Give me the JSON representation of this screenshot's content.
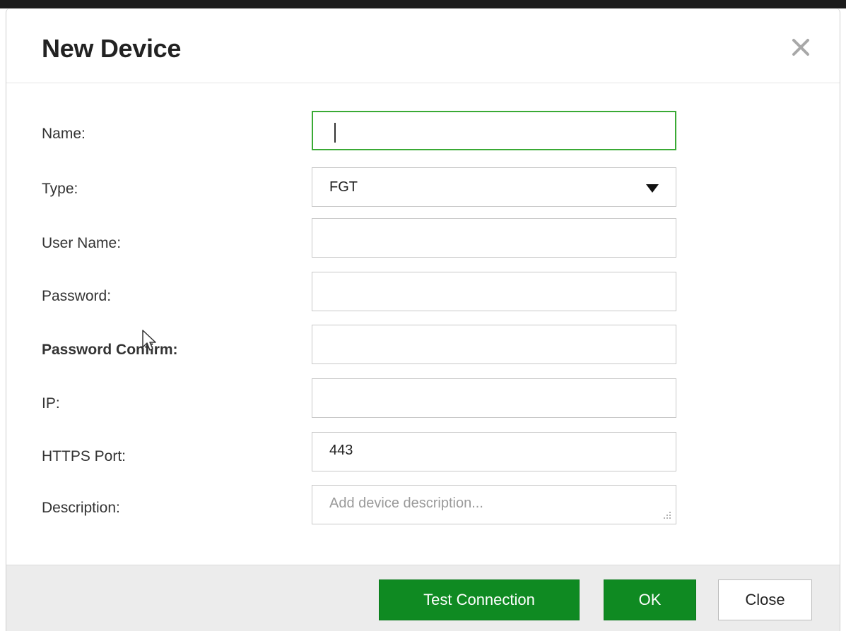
{
  "dialog": {
    "title": "New Device",
    "close_icon": "close-icon"
  },
  "form": {
    "name": {
      "label": "Name:",
      "value": ""
    },
    "type": {
      "label": "Type:",
      "value": "FGT"
    },
    "user_name": {
      "label": "User Name:",
      "value": ""
    },
    "password": {
      "label": "Password:",
      "value": ""
    },
    "password_confirm": {
      "label": "Password Confirm:",
      "value": ""
    },
    "ip": {
      "label": "IP:",
      "value": ""
    },
    "https_port": {
      "label": "HTTPS Port:",
      "value": "443"
    },
    "description": {
      "label": "Description:",
      "value": "",
      "placeholder": "Add device description..."
    }
  },
  "footer": {
    "test_connection_label": "Test Connection",
    "ok_label": "OK",
    "close_label": "Close"
  },
  "colors": {
    "primary_green": "#0f8a22",
    "focus_green": "#3aaa35"
  }
}
